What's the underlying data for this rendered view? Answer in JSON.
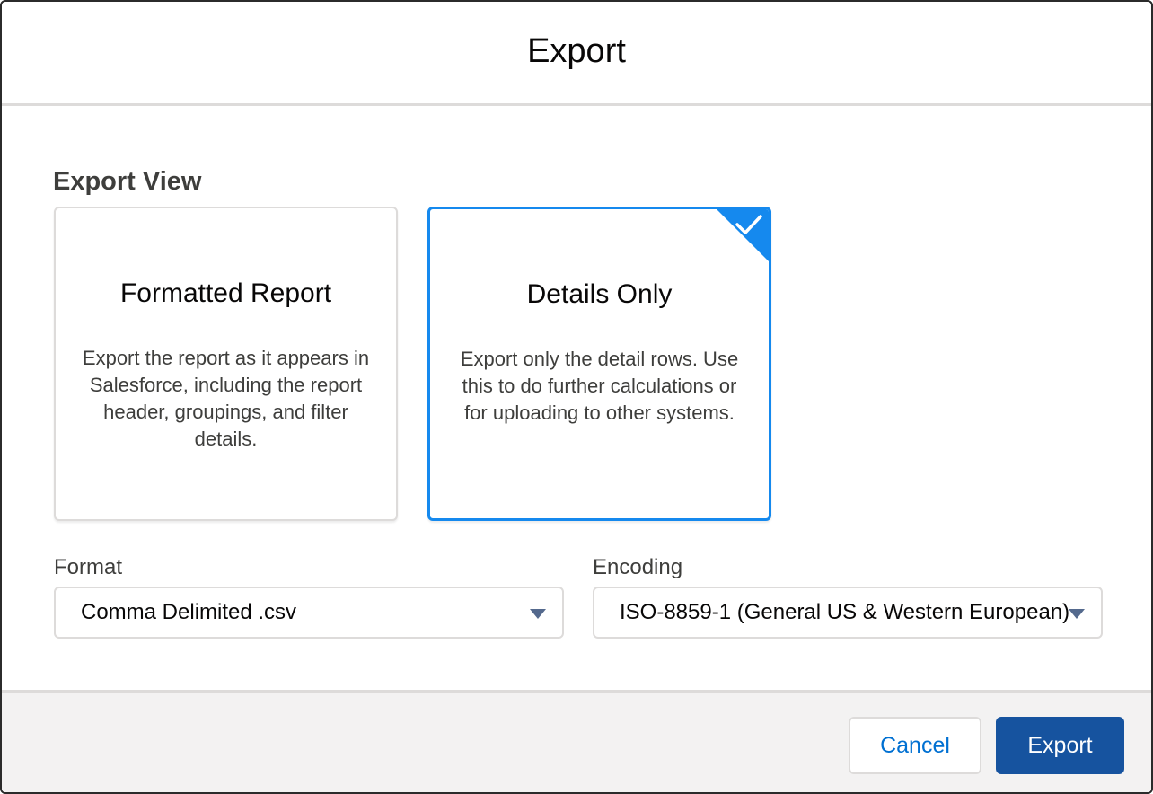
{
  "dialog": {
    "title": "Export"
  },
  "export_view": {
    "heading": "Export View",
    "options": [
      {
        "title": "Formatted Report",
        "description": "Export the report as it appears in Salesforce, including the report header, groupings, and filter details.",
        "selected": false
      },
      {
        "title": "Details Only",
        "description": "Export only the detail rows. Use this to do further calculations or for uploading to other systems.",
        "selected": true
      }
    ]
  },
  "format": {
    "label": "Format",
    "value": "Comma Delimited .csv"
  },
  "encoding": {
    "label": "Encoding",
    "value": "ISO-8859-1 (General US & Western European)"
  },
  "footer": {
    "cancel_label": "Cancel",
    "export_label": "Export"
  },
  "colors": {
    "selected_border": "#1589ee",
    "primary_button": "#16539f",
    "link_text": "#0070d2"
  }
}
